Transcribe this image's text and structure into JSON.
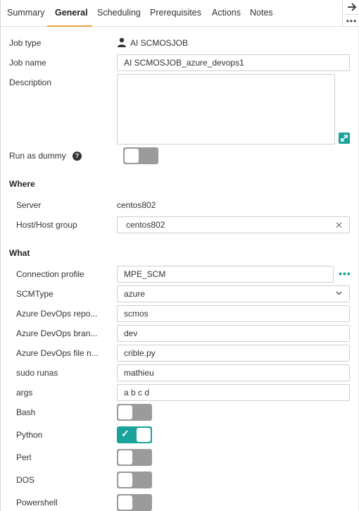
{
  "tabs": [
    {
      "label": "Summary"
    },
    {
      "label": "General"
    },
    {
      "label": "Scheduling"
    },
    {
      "label": "Prerequisites"
    },
    {
      "label": "Actions"
    },
    {
      "label": "Notes"
    }
  ],
  "active_tab": "General",
  "side": {
    "arrow_icon": "arrow-right-icon",
    "more_icon": "more-dots-icon"
  },
  "general": {
    "job_type_label": "Job type",
    "job_type_value": "AI SCMOSJOB",
    "job_name_label": "Job name",
    "job_name_value": "AI SCMOSJOB_azure_devops1",
    "description_label": "Description",
    "description_value": "",
    "run_as_dummy_label": "Run as dummy",
    "run_as_dummy_help": "?",
    "run_as_dummy_on": false
  },
  "where": {
    "title": "Where",
    "server_label": "Server",
    "server_value": "centos802",
    "host_label": "Host/Host group",
    "host_value": "centos802",
    "host_clear": "✕"
  },
  "what": {
    "title": "What",
    "connection_profile_label": "Connection profile",
    "connection_profile_value": "MPE_SCM",
    "connection_profile_more": "•••",
    "scmtype_label": "SCMType",
    "scmtype_value": "azure",
    "repo_label": "Azure DevOps repo...",
    "repo_value": "scmos",
    "branch_label": "Azure DevOps bran...",
    "branch_value": "dev",
    "file_label": "Azure DevOps file n...",
    "file_value": "crible.py",
    "sudo_label": "sudo runas",
    "sudo_value": "mathieu",
    "args_label": "args",
    "args_value": "a b c d",
    "bash_label": "Bash",
    "bash_on": false,
    "python_label": "Python",
    "python_on": true,
    "perl_label": "Perl",
    "perl_on": false,
    "dos_label": "DOS",
    "dos_on": false,
    "powershell_label": "Powershell",
    "powershell_on": false
  },
  "colors": {
    "accent": "#1aa39a",
    "tab_underline": "#e6a23c",
    "toggle_off": "#9b9b9b"
  }
}
